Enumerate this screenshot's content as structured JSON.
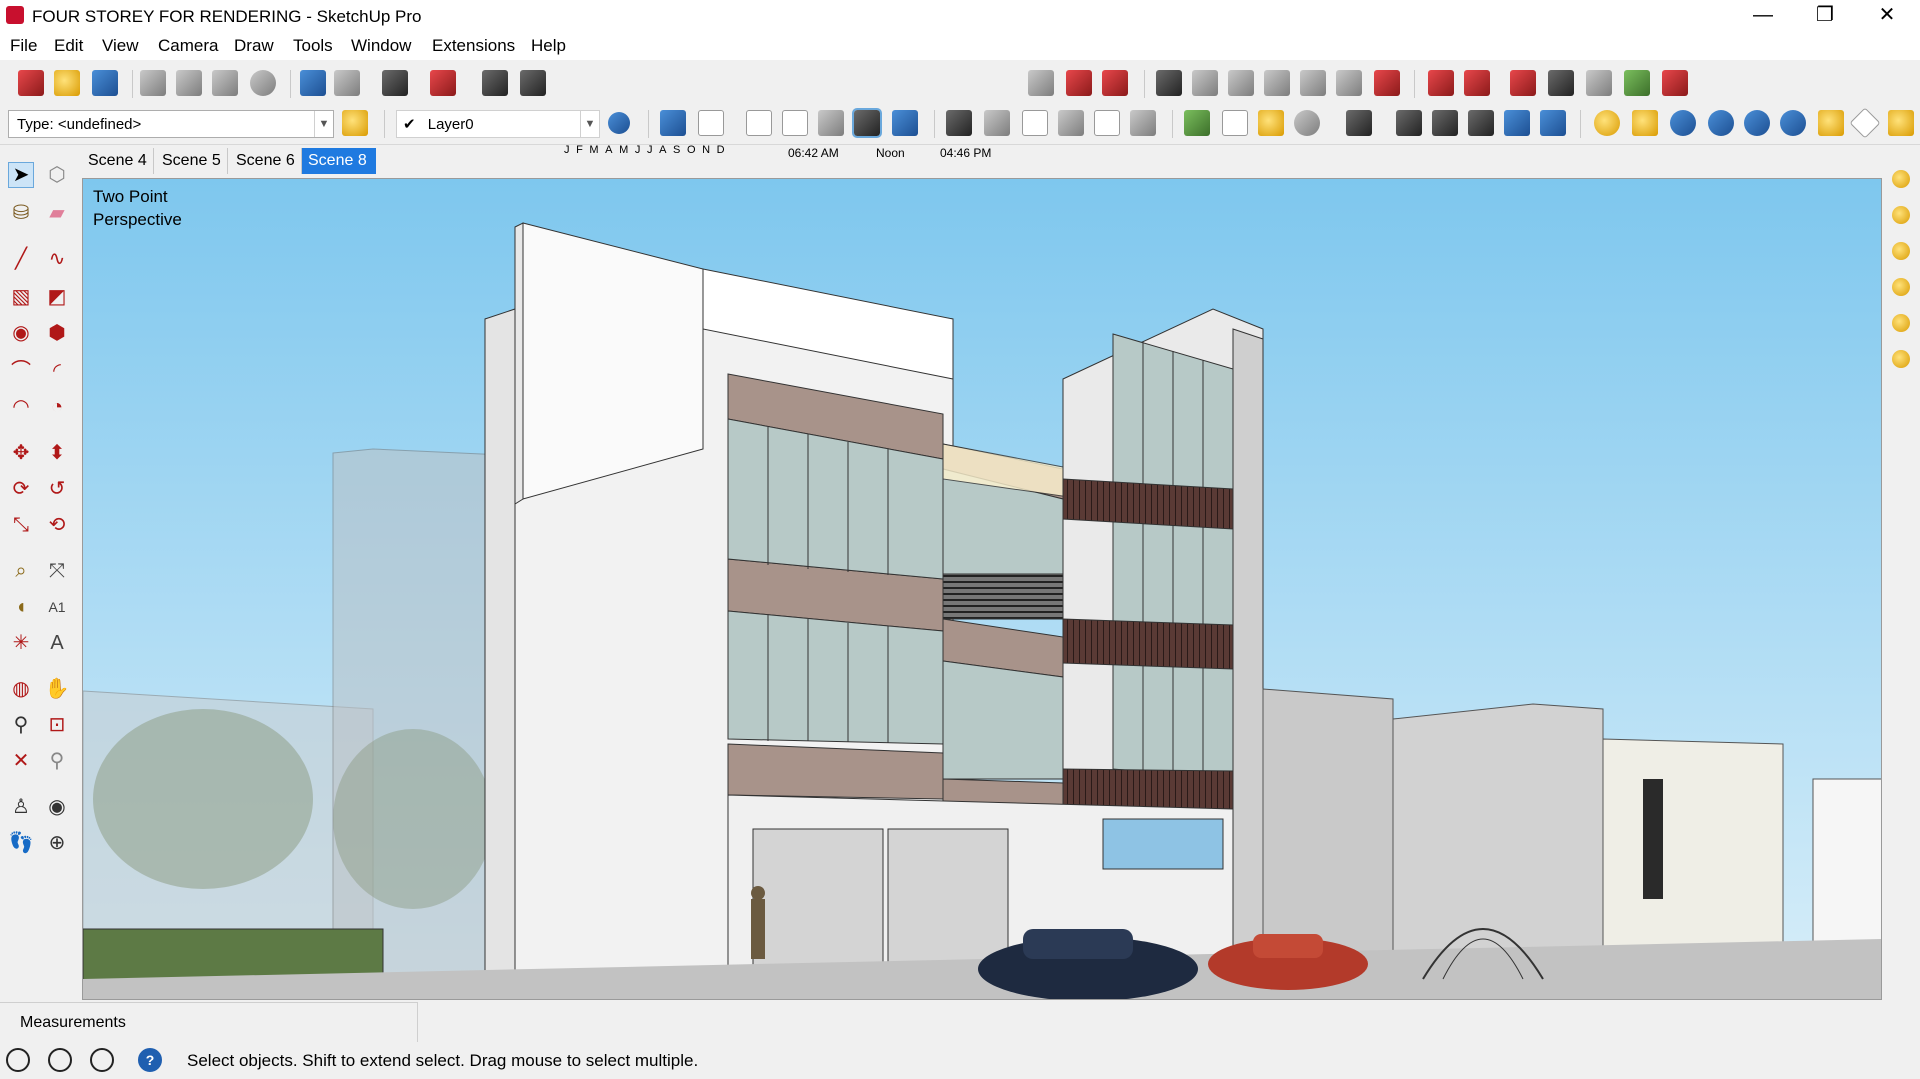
{
  "window": {
    "title": "FOUR STOREY FOR RENDERING - SketchUp Pro",
    "minimize": "—",
    "restore": "❐",
    "close": "✕"
  },
  "menu": [
    "File",
    "Edit",
    "View",
    "Camera",
    "Draw",
    "Tools",
    "Window",
    "Extensions",
    "Help"
  ],
  "toolbar": {
    "type_field": "Type: <undefined>",
    "layer_field": "Layer0",
    "layer_check": "✔",
    "shadow_months": "JFMAMJJASOND",
    "time_start": "06:42 AM",
    "time_noon": "Noon",
    "time_end": "04:46 PM"
  },
  "scenes": {
    "tabs": [
      "Scene 4",
      "Scene 5",
      "Scene 6",
      "Scene 8"
    ],
    "active": "Scene 8"
  },
  "viewport": {
    "camera_label": "Two Point\nPerspective"
  },
  "measurements": {
    "label": "Measurements"
  },
  "status": {
    "text": "Select objects. Shift to extend select. Drag mouse to select multiple.",
    "geo_icon": "geo-location-icon",
    "credits_icon": "credits-icon",
    "user_icon": "user-icon",
    "help_icon": "help-icon",
    "help_glyph": "?"
  },
  "colors": {
    "active_tab": "#1f7ae0",
    "sky_top": "#7ec7ee",
    "sky_bottom": "#d8eef9",
    "facade_brown": "#a8938a",
    "wall_white": "#f2f2f2",
    "ground": "#c2c2c2"
  }
}
